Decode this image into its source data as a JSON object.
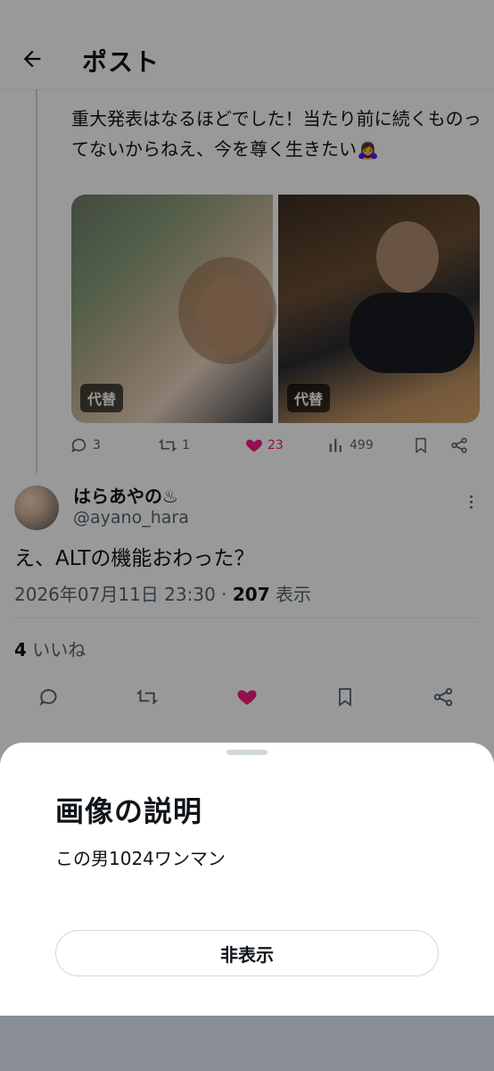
{
  "header": {
    "title": "ポスト"
  },
  "parent_post": {
    "text": "重大発表はなるほどでした！当たり前に続くものってないからねえ、今を尊く生きたい🙇‍♀️",
    "media": [
      {
        "alt_badge": "代替"
      },
      {
        "alt_badge": "代替"
      }
    ],
    "stats": {
      "replies": "3",
      "reposts": "1",
      "likes": "23",
      "views": "499"
    }
  },
  "reply": {
    "display_name": "はらあやの♨",
    "handle": "@ayano_hara",
    "text": "え、ALTの機能おわった？",
    "timestamp": "2026年07月11日 23:30",
    "separator": "·",
    "views_count": "207",
    "views_label": "表示",
    "likes_count": "4",
    "likes_label": "いいね"
  },
  "alt_sheet": {
    "title": "画像の説明",
    "description": "この男1024ワンマン",
    "hide_button": "非表示"
  },
  "colors": {
    "like_pink": "#f91880",
    "text_primary": "#0f1419",
    "text_secondary": "#536471",
    "overlay": "rgba(0,0,0,0.40)"
  },
  "icons": {
    "back": "arrow-left-icon",
    "reply": "comment-icon",
    "repost": "repost-icon",
    "like": "heart-icon",
    "views": "bar-chart-icon",
    "bookmark": "bookmark-icon",
    "share": "share-icon",
    "more": "more-vertical-icon"
  }
}
